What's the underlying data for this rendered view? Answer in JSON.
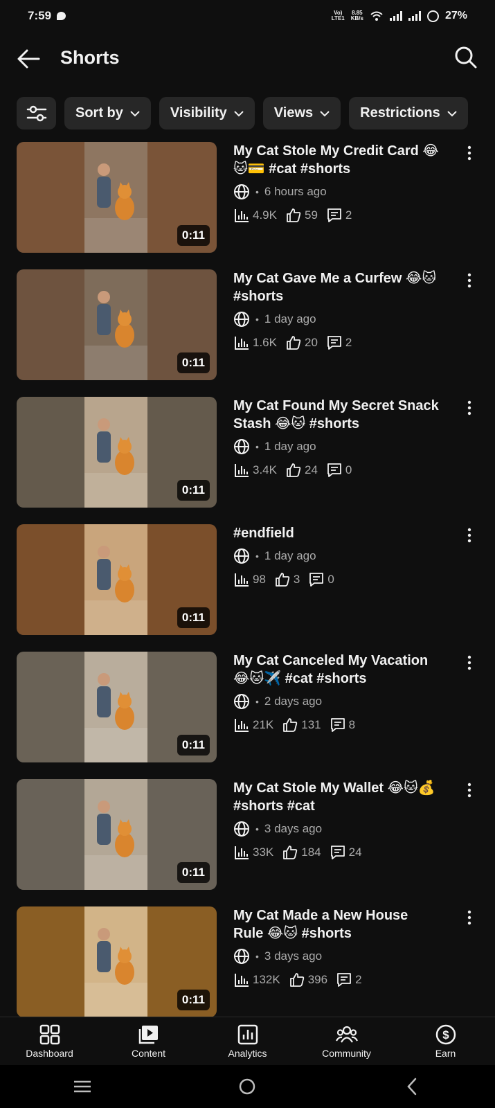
{
  "status_bar": {
    "time": "7:59",
    "net_top": "Vo)",
    "net_bottom": "LTE1",
    "speed_top": "8.85",
    "speed_bottom": "KB/s",
    "battery": "27%"
  },
  "header": {
    "title": "Shorts"
  },
  "filters": [
    {
      "label": "Sort by"
    },
    {
      "label": "Visibility"
    },
    {
      "label": "Views"
    },
    {
      "label": "Restrictions"
    }
  ],
  "videos": [
    {
      "title": "My Cat Stole My Credit Card 😂🐱💳 #cat #shorts",
      "visibility_icon": "globe-icon",
      "age": "6 hours ago",
      "views": "4.9K",
      "likes": "59",
      "comments": "2",
      "duration": "0:11",
      "thumb_bg": "#7a5438",
      "thumb_center": "#8e7661"
    },
    {
      "title": "My Cat Gave Me a Curfew 😂🐱 #shorts",
      "visibility_icon": "globe-icon",
      "age": "1 day ago",
      "views": "1.6K",
      "likes": "20",
      "comments": "2",
      "duration": "0:11",
      "thumb_bg": "#6e533f",
      "thumb_center": "#7e6c5a"
    },
    {
      "title": "My Cat Found My Secret Snack Stash 😂🐱 #shorts",
      "visibility_icon": "globe-icon",
      "age": "1 day ago",
      "views": "3.4K",
      "likes": "24",
      "comments": "0",
      "duration": "0:11",
      "thumb_bg": "#645a4c",
      "thumb_center": "#b8a58d"
    },
    {
      "title": "#endfield",
      "visibility_icon": "globe-icon",
      "age": "1 day ago",
      "views": "98",
      "likes": "3",
      "comments": "0",
      "duration": "0:11",
      "thumb_bg": "#7b4f2b",
      "thumb_center": "#c9a57c"
    },
    {
      "title": "My Cat Canceled My Vacation 😂🐱✈️ #cat #shorts",
      "visibility_icon": "globe-icon",
      "age": "2 days ago",
      "views": "21K",
      "likes": "131",
      "comments": "8",
      "duration": "0:11",
      "thumb_bg": "#6a6256",
      "thumb_center": "#b9ad9c"
    },
    {
      "title": "My Cat Stole My Wallet 😂🐱💰 #shorts #cat",
      "visibility_icon": "globe-icon",
      "age": "3 days ago",
      "views": "33K",
      "likes": "184",
      "comments": "24",
      "duration": "0:11",
      "thumb_bg": "#696258",
      "thumb_center": "#b3a796"
    },
    {
      "title": "My Cat Made a New House Rule 😂🐱 #shorts",
      "visibility_icon": "globe-icon",
      "age": "3 days ago",
      "views": "132K",
      "likes": "396",
      "comments": "2",
      "duration": "0:11",
      "thumb_bg": "#8a5e24",
      "thumb_center": "#d2b488"
    }
  ],
  "bottom_nav": [
    {
      "label": "Dashboard",
      "icon": "dashboard-icon"
    },
    {
      "label": "Content",
      "icon": "content-icon"
    },
    {
      "label": "Analytics",
      "icon": "analytics-icon"
    },
    {
      "label": "Community",
      "icon": "community-icon"
    },
    {
      "label": "Earn",
      "icon": "earn-icon"
    }
  ],
  "colors": {
    "background": "#0f0f0f",
    "chip": "#272727",
    "secondary_text": "#aaaaaa"
  }
}
